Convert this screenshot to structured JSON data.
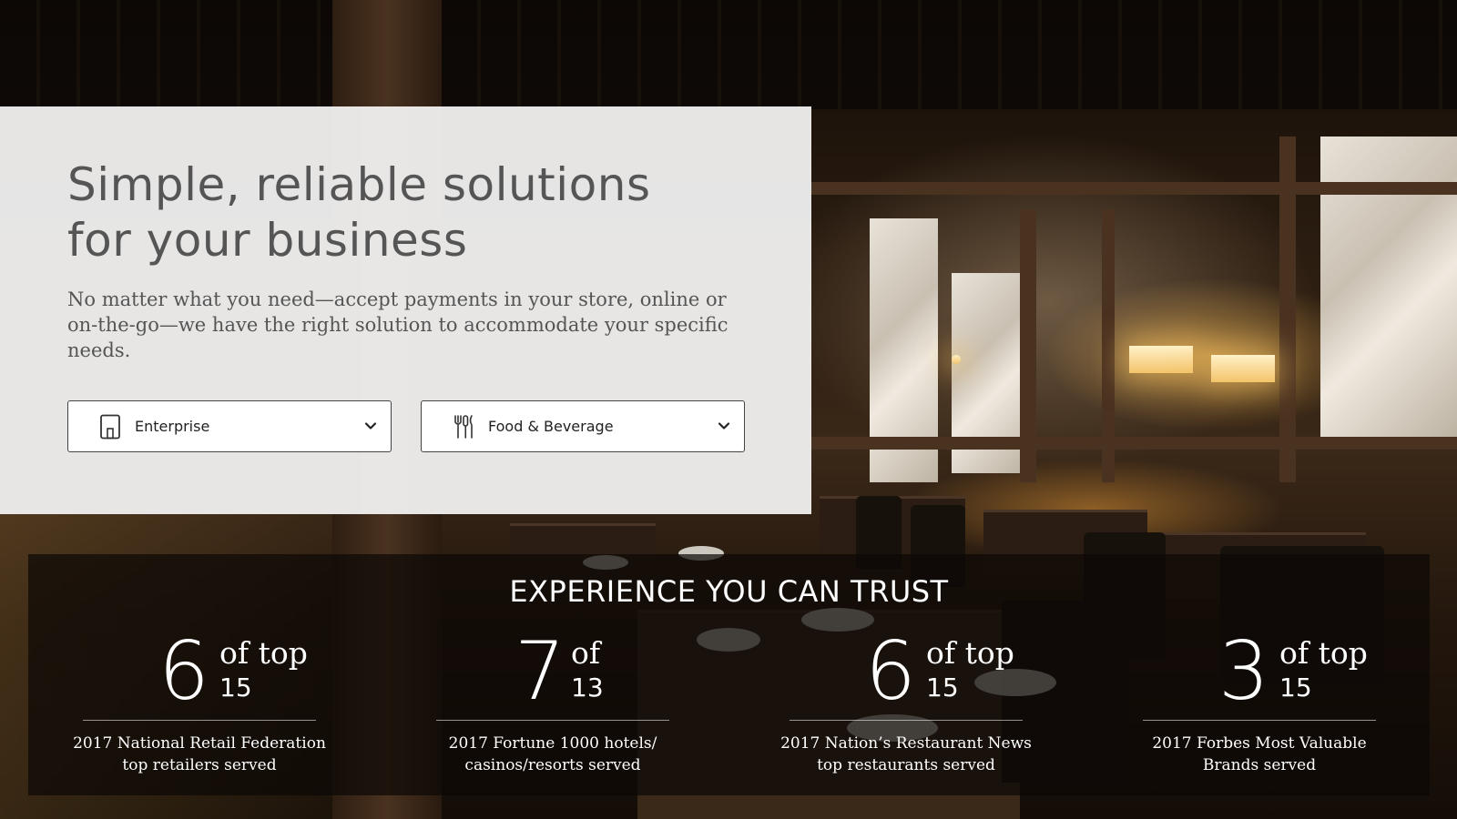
{
  "hero": {
    "title": "Simple, reliable solutions for your business",
    "description": "No matter what you need—accept payments in your store, online or on-the-go—we have the right solution to accommodate your specific needs.",
    "segment_select": {
      "value": "Enterprise",
      "icon": "building-icon"
    },
    "industry_select": {
      "value": "Food & Beverage",
      "icon": "utensils-icon"
    }
  },
  "stats": {
    "heading": "EXPERIENCE YOU CAN TRUST",
    "items": [
      {
        "value": "6",
        "of": "of top",
        "total": "15",
        "caption": "2017 National Retail Federation top retailers served"
      },
      {
        "value": "7",
        "of": "of",
        "total": "13",
        "caption": "2017 Fortune 1000 hotels/ casinos/resorts served"
      },
      {
        "value": "6",
        "of": "of top",
        "total": "15",
        "caption": "2017 Nation’s Restaurant News top restaurants served"
      },
      {
        "value": "3",
        "of": "of top",
        "total": "15",
        "caption": "2017 Forbes Most Valuable Brands served"
      }
    ]
  },
  "colors": {
    "panel": "#f5f5f5",
    "text": "#555555",
    "stats_text": "#ffffff"
  }
}
